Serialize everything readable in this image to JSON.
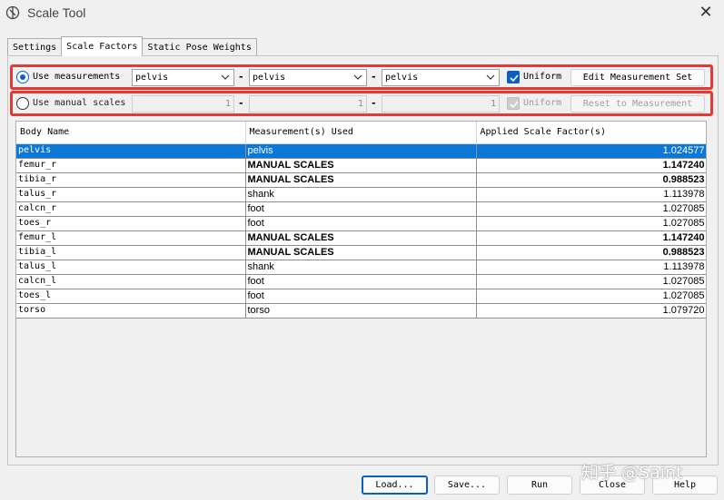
{
  "window": {
    "title": "Scale Tool",
    "icon": "app-logo-icon"
  },
  "tabs": [
    {
      "label": "Settings",
      "active": false
    },
    {
      "label": "Scale Factors",
      "active": true
    },
    {
      "label": "Static Pose Weights",
      "active": false
    }
  ],
  "measurements_row": {
    "label": "Use measurements",
    "selected": true,
    "x_value": "pelvis",
    "y_value": "pelvis",
    "z_value": "pelvis",
    "separator": "-",
    "uniform_label": "Uniform",
    "uniform_checked": true,
    "edit_button": "Edit Measurement Set"
  },
  "manual_row": {
    "label": "Use manual scales",
    "selected": false,
    "x_value": "1",
    "y_value": "1",
    "z_value": "1",
    "separator": "-",
    "uniform_label": "Uniform",
    "uniform_checked": true,
    "reset_button": "Reset to Measurement"
  },
  "table": {
    "headers": [
      "Body Name",
      "Measurement(s) Used",
      "Applied Scale Factor(s)"
    ],
    "rows": [
      {
        "body": "pelvis",
        "measurement": "pelvis",
        "factor": "1.024577",
        "selected": true,
        "bold": false
      },
      {
        "body": "femur_r",
        "measurement": "MANUAL SCALES",
        "factor": "1.147240",
        "selected": false,
        "bold": true
      },
      {
        "body": "tibia_r",
        "measurement": "MANUAL SCALES",
        "factor": "0.988523",
        "selected": false,
        "bold": true
      },
      {
        "body": "talus_r",
        "measurement": "shank",
        "factor": "1.113978",
        "selected": false,
        "bold": false
      },
      {
        "body": "calcn_r",
        "measurement": "foot",
        "factor": "1.027085",
        "selected": false,
        "bold": false
      },
      {
        "body": "toes_r",
        "measurement": "foot",
        "factor": "1.027085",
        "selected": false,
        "bold": false
      },
      {
        "body": "femur_l",
        "measurement": "MANUAL SCALES",
        "factor": "1.147240",
        "selected": false,
        "bold": true
      },
      {
        "body": "tibia_l",
        "measurement": "MANUAL SCALES",
        "factor": "0.988523",
        "selected": false,
        "bold": true
      },
      {
        "body": "talus_l",
        "measurement": "shank",
        "factor": "1.113978",
        "selected": false,
        "bold": false
      },
      {
        "body": "calcn_l",
        "measurement": "foot",
        "factor": "1.027085",
        "selected": false,
        "bold": false
      },
      {
        "body": "toes_l",
        "measurement": "foot",
        "factor": "1.027085",
        "selected": false,
        "bold": false
      },
      {
        "body": "torso",
        "measurement": "torso",
        "factor": "1.079720",
        "selected": false,
        "bold": false
      }
    ]
  },
  "footer": {
    "load": "Load...",
    "save": "Save...",
    "run": "Run",
    "close": "Close",
    "help": "Help"
  },
  "watermark": "知乎 @Saint",
  "colors": {
    "accent": "#0b5fc2",
    "selection": "#0b78d7",
    "highlight_border": "#e53935"
  }
}
